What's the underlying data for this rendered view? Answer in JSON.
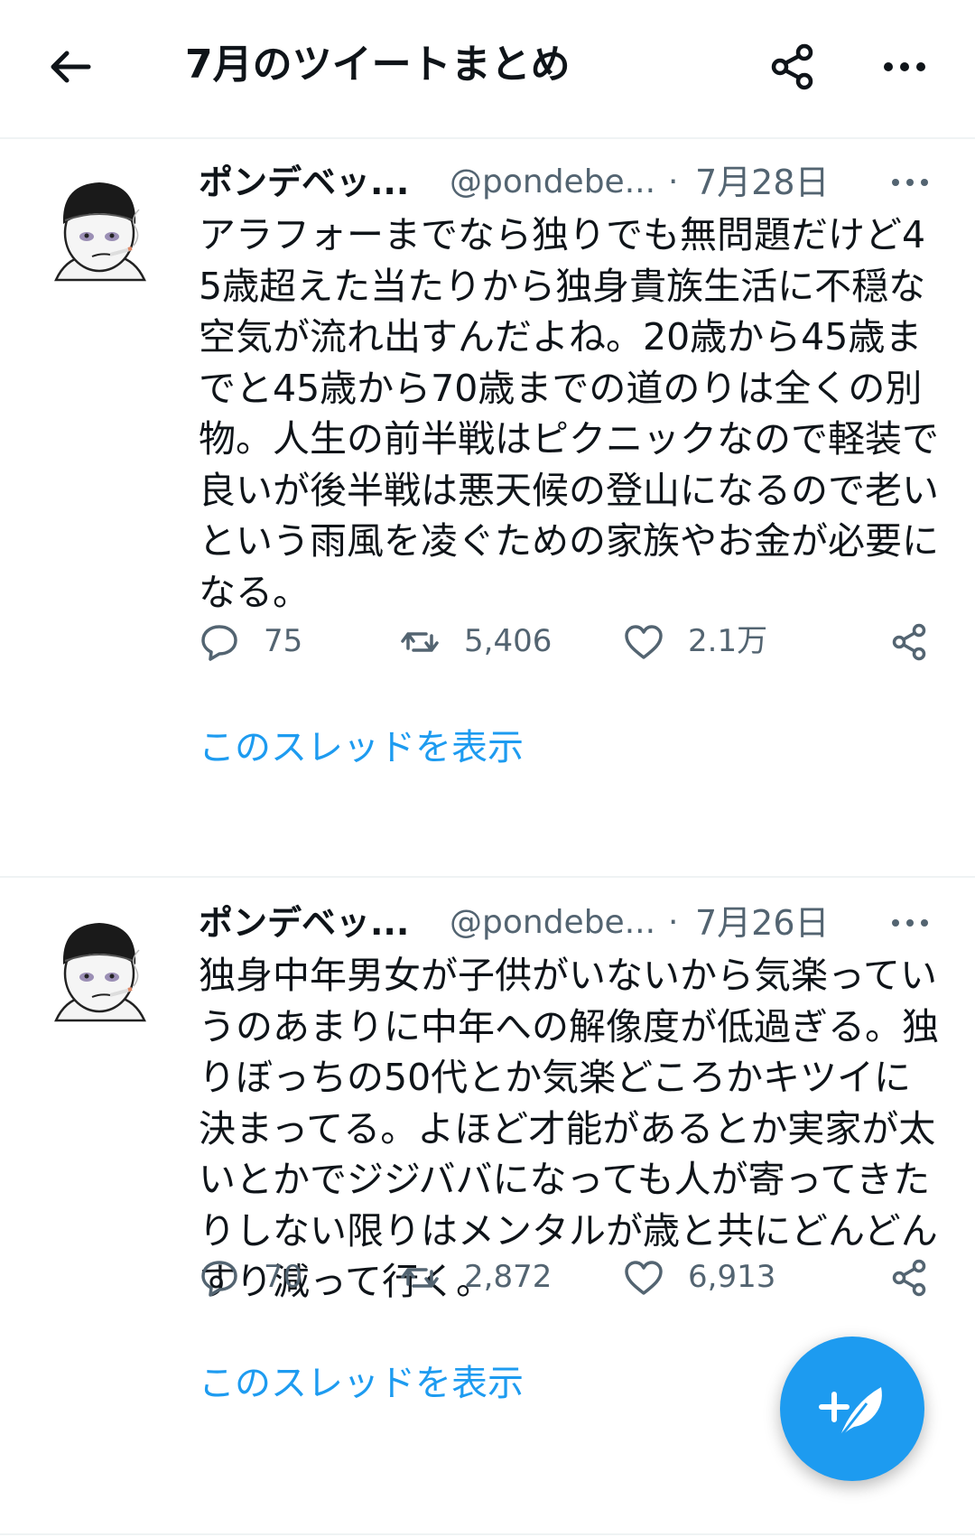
{
  "header": {
    "title": "7月のツイートまとめ"
  },
  "tweets": [
    {
      "display_name": "ポンデベッ...",
      "handle": "@pondebe...",
      "separator": "·",
      "date": "7月28日",
      "text": "アラフォーまでなら独りでも無問題だけど45歳超えた当たりから独身貴族生活に不穏な空気が流れ出すんだよね。20歳から45歳までと45歳から70歳までの道のりは全くの別物。人生の前半戦はピクニックなので軽装で良いが後半戦は悪天候の登山になるので老いという雨風を凌ぐための家族やお金が必要になる。",
      "replies": "75",
      "retweets": "5,406",
      "likes": "2.1万",
      "show_thread": "このスレッドを表示"
    },
    {
      "display_name": "ポンデベッ...",
      "handle": "@pondebe...",
      "separator": "·",
      "date": "7月26日",
      "text": "独身中年男女が子供がいないから気楽っていうのあまりに中年への解像度が低過ぎる。独りぼっちの50代とか気楽どころかキツイに決まってる。よほど才能があるとか実家が太いとかでジジババになっても人が寄ってきたりしない限りはメンタルが歳と共にどんどんすり減って行く。",
      "replies": "70",
      "retweets": "2,872",
      "likes": "6,913",
      "show_thread": "このスレッドを表示"
    }
  ],
  "colors": {
    "accent": "#1d9bf0",
    "text_primary": "#0f1419",
    "text_secondary": "#536471",
    "divider": "#eff3f4"
  },
  "icons": {
    "back": "arrow-left-icon",
    "share": "share-icon",
    "more": "more-horizontal-icon",
    "reply": "reply-icon",
    "retweet": "retweet-icon",
    "like": "heart-icon",
    "compose": "compose-feather-icon"
  }
}
